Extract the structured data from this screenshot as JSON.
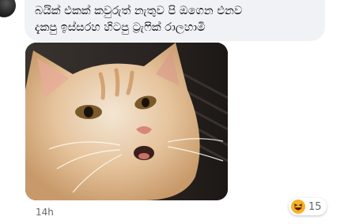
{
  "comment": {
    "text": "බයික් එකක් කවුරුත් නැතුව පි ඔගෙන එනව\nදැකපු ඉස්සරහ හිටපු ට්‍රැෆික් රාලහාමි"
  },
  "meta": {
    "timestamp": "14h"
  },
  "reactions": {
    "icon": "haha-emoji-icon",
    "count": "15"
  },
  "colors": {
    "bubble_bg": "#f0f2f5",
    "meta_text": "#65676b",
    "emoji_yellow": "#f7b125"
  }
}
